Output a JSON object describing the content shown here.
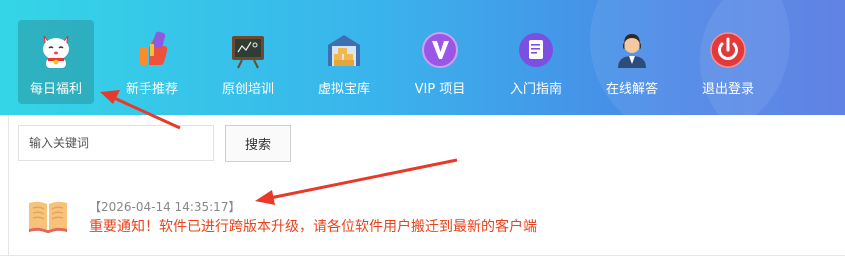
{
  "nav": {
    "items": [
      {
        "label": "每日福利",
        "icon": "lucky-cat-icon",
        "active": true
      },
      {
        "label": "新手推荐",
        "icon": "thumbs-up-icon",
        "active": false
      },
      {
        "label": "原创培训",
        "icon": "chalkboard-icon",
        "active": false
      },
      {
        "label": "虚拟宝库",
        "icon": "warehouse-icon",
        "active": false
      },
      {
        "label": "VIP 项目",
        "icon": "vip-badge-icon",
        "active": false
      },
      {
        "label": "入门指南",
        "icon": "guide-document-icon",
        "active": false
      },
      {
        "label": "在线解答",
        "icon": "support-agent-icon",
        "active": false
      },
      {
        "label": "退出登录",
        "icon": "power-icon",
        "active": false
      }
    ]
  },
  "search": {
    "placeholder": "输入关键词",
    "button_label": "搜索"
  },
  "notice": {
    "timestamp": "【2026-04-14 14:35:17】",
    "text": "重要通知！软件已进行跨版本升级，请各位软件用户搬迁到最新的客户端",
    "icon": "open-book-icon"
  },
  "colors": {
    "accent": "#e8431c",
    "annotation_arrow": "#e8392a",
    "nav_start": "#34d6e6",
    "nav_end": "#5378e2"
  }
}
